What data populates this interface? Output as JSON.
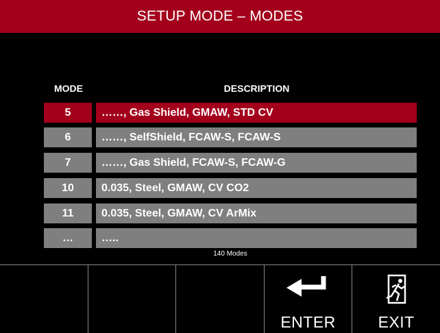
{
  "title": "SETUP MODE –  MODES",
  "headers": {
    "mode": "MODE",
    "description": "DESCRIPTION"
  },
  "rows": [
    {
      "mode": "5",
      "description": "……, Gas Shield, GMAW, STD CV",
      "selected": true
    },
    {
      "mode": "6",
      "description": "……, SelfShield, FCAW-S, FCAW-S",
      "selected": false
    },
    {
      "mode": "7",
      "description": "……, Gas Shield, FCAW-S, FCAW-G",
      "selected": false
    },
    {
      "mode": "10",
      "description": "0.035, Steel, GMAW, CV CO2",
      "selected": false
    },
    {
      "mode": "11",
      "description": "0.035, Steel, GMAW, CV ArMix",
      "selected": false
    },
    {
      "mode": "…",
      "description": "…..",
      "selected": false
    }
  ],
  "mode_count": "140 Modes",
  "function_keys": [
    {
      "label": "",
      "icon": ""
    },
    {
      "label": "",
      "icon": ""
    },
    {
      "label": "",
      "icon": ""
    },
    {
      "label": "ENTER",
      "icon": "enter-arrow-icon"
    },
    {
      "label": "EXIT",
      "icon": "exit-door-icon"
    }
  ],
  "colors": {
    "accent": "#a3001c",
    "row_bg": "#7f7f7f",
    "background": "#000000"
  }
}
